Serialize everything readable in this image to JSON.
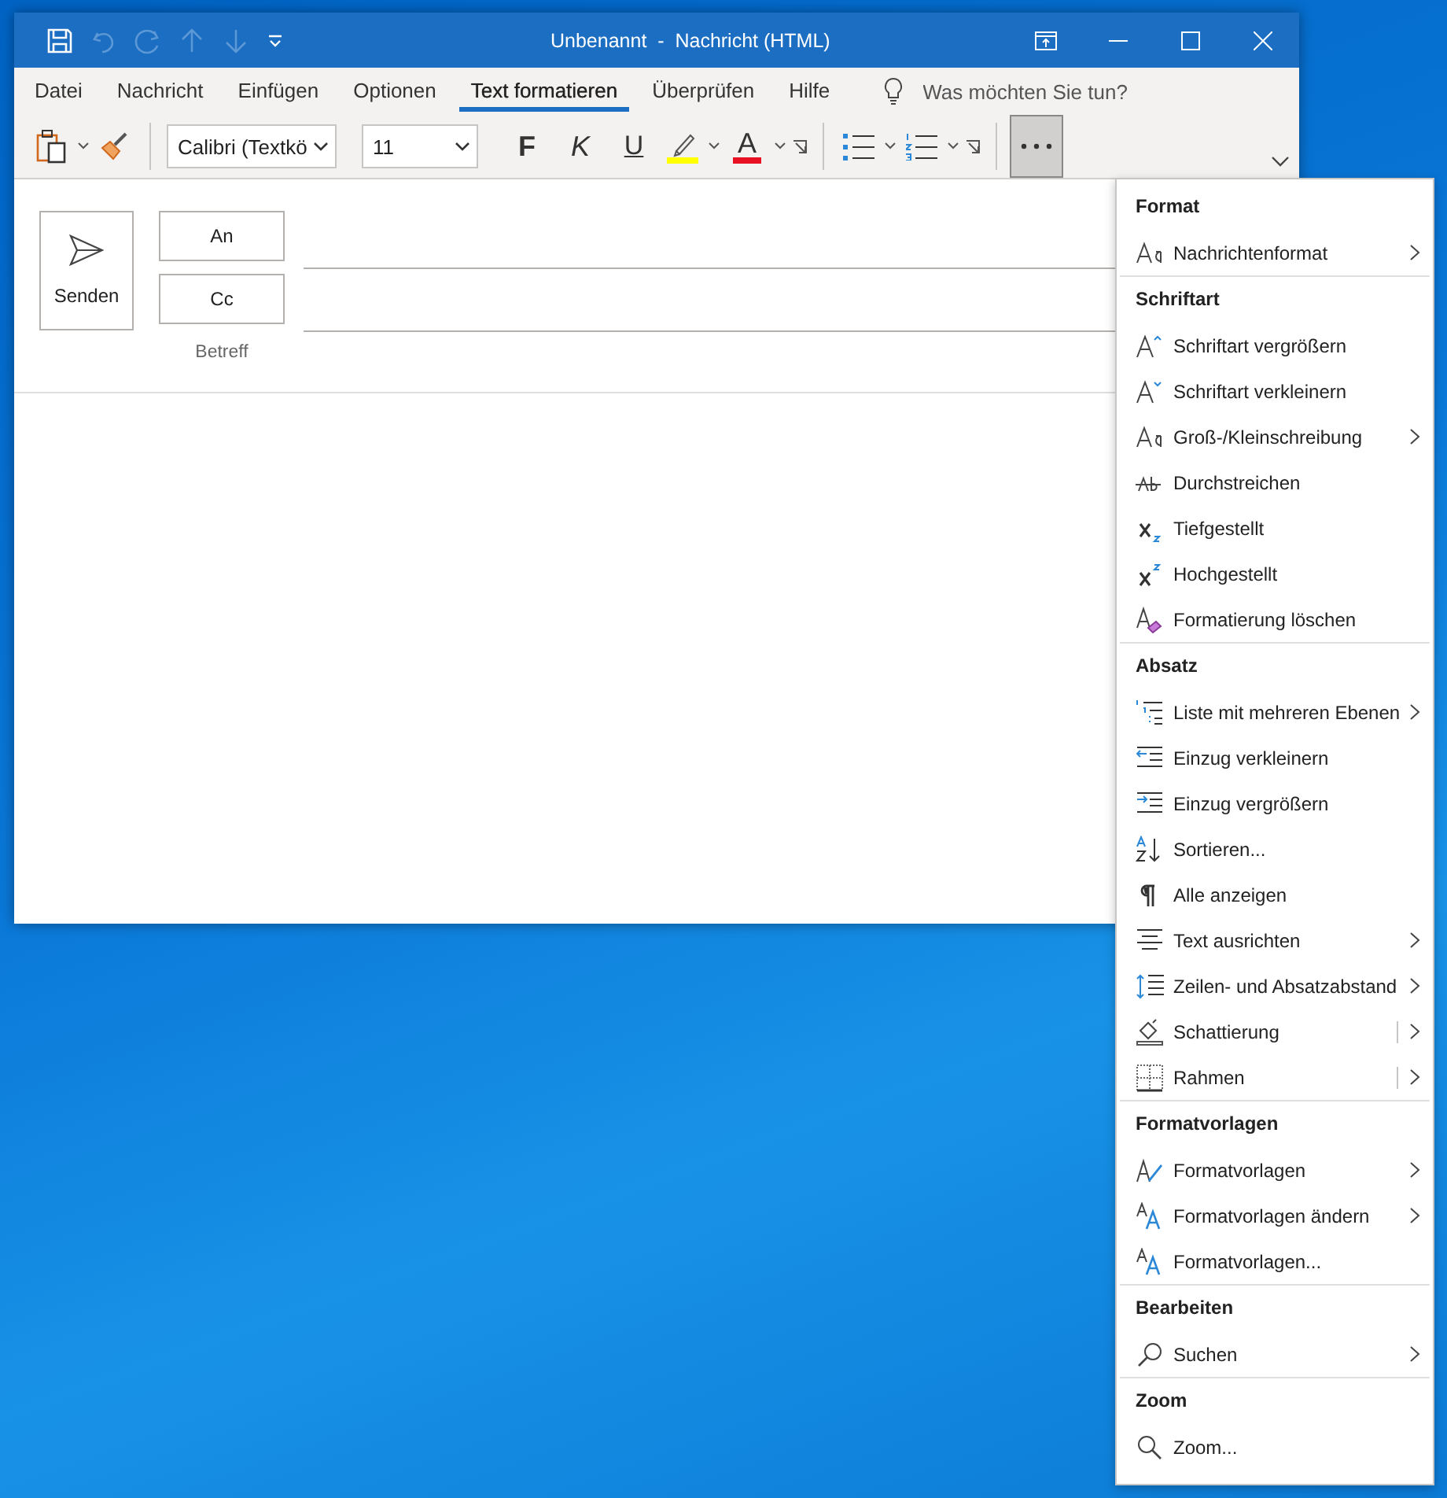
{
  "window": {
    "title": "Unbenannt  -  Nachricht (HTML)"
  },
  "ribbon_tabs": [
    {
      "label": "Datei",
      "selected": false
    },
    {
      "label": "Nachricht",
      "selected": false
    },
    {
      "label": "Einfügen",
      "selected": false
    },
    {
      "label": "Optionen",
      "selected": false
    },
    {
      "label": "Text formatieren",
      "selected": true
    },
    {
      "label": "Überprüfen",
      "selected": false
    },
    {
      "label": "Hilfe",
      "selected": false
    }
  ],
  "tell_me": {
    "placeholder": "Was möchten Sie tun?"
  },
  "toolbar": {
    "font": "Calibri (Textkö",
    "size": "11",
    "bold": "F",
    "italic": "K",
    "underline": "U",
    "font_color": "A",
    "more_pressed": true
  },
  "compose": {
    "send": "Senden",
    "to": "An",
    "cc": "Cc",
    "subject": "Betreff"
  },
  "menu": [
    {
      "heading": "Format",
      "items": [
        {
          "label": "Nachrichtenformat",
          "submenu": true,
          "split": false
        }
      ]
    },
    {
      "heading": "Schriftart",
      "items": [
        {
          "label": "Schriftart vergrößern",
          "submenu": false,
          "split": false
        },
        {
          "label": "Schriftart verkleinern",
          "submenu": false,
          "split": false
        },
        {
          "label": "Groß-/Kleinschreibung",
          "submenu": true,
          "split": false
        },
        {
          "label": "Durchstreichen",
          "submenu": false,
          "split": false
        },
        {
          "label": "Tiefgestellt",
          "submenu": false,
          "split": false
        },
        {
          "label": "Hochgestellt",
          "submenu": false,
          "split": false
        },
        {
          "label": "Formatierung löschen",
          "submenu": false,
          "split": false
        }
      ]
    },
    {
      "heading": "Absatz",
      "items": [
        {
          "label": "Liste mit mehreren Ebenen",
          "submenu": true,
          "split": false
        },
        {
          "label": "Einzug verkleinern",
          "submenu": false,
          "split": false
        },
        {
          "label": "Einzug vergrößern",
          "submenu": false,
          "split": false
        },
        {
          "label": "Sortieren...",
          "submenu": false,
          "split": false
        },
        {
          "label": "Alle anzeigen",
          "submenu": false,
          "split": false
        },
        {
          "label": "Text ausrichten",
          "submenu": true,
          "split": false
        },
        {
          "label": "Zeilen- und Absatzabstand",
          "submenu": true,
          "split": false
        },
        {
          "label": "Schattierung",
          "submenu": true,
          "split": true
        },
        {
          "label": "Rahmen",
          "submenu": true,
          "split": true
        }
      ]
    },
    {
      "heading": "Formatvorlagen",
      "items": [
        {
          "label": "Formatvorlagen",
          "submenu": true,
          "split": false
        },
        {
          "label": "Formatvorlagen ändern",
          "submenu": true,
          "split": false
        },
        {
          "label": "Formatvorlagen...",
          "submenu": false,
          "split": false
        }
      ]
    },
    {
      "heading": "Bearbeiten",
      "items": [
        {
          "label": "Suchen",
          "submenu": true,
          "split": false
        }
      ]
    },
    {
      "heading": "Zoom",
      "items": [
        {
          "label": "Zoom...",
          "submenu": false,
          "split": false
        }
      ]
    }
  ]
}
